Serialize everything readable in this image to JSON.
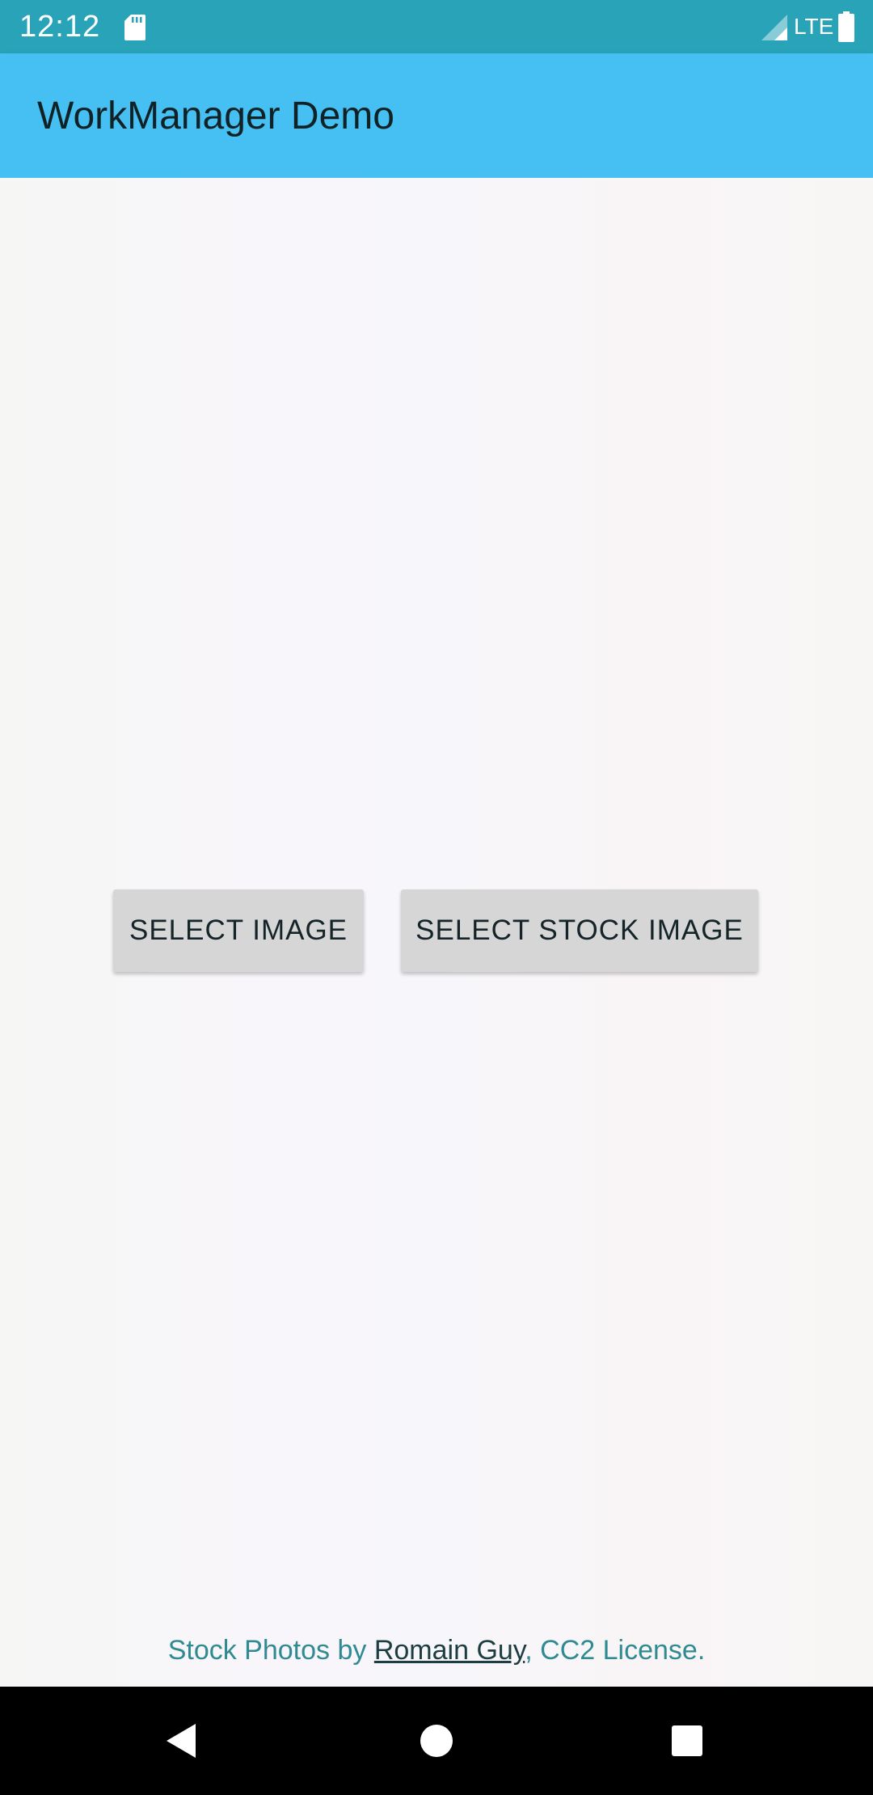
{
  "status_bar": {
    "time": "12:12",
    "network_type": "LTE",
    "background_color": "#29a3b8",
    "icons": [
      "sd-card-icon",
      "signal-icon",
      "battery-icon"
    ]
  },
  "app_bar": {
    "title": "WorkManager Demo",
    "background_color": "#46c0f2"
  },
  "main": {
    "buttons": {
      "select_image": "SELECT IMAGE",
      "select_stock_image": "SELECT STOCK IMAGE"
    },
    "credit": {
      "prefix": "Stock Photos by ",
      "author": "Romain Guy",
      "suffix": ", CC2 License."
    }
  },
  "nav_bar": {
    "icons": [
      "back-icon",
      "home-icon",
      "recents-icon"
    ]
  }
}
